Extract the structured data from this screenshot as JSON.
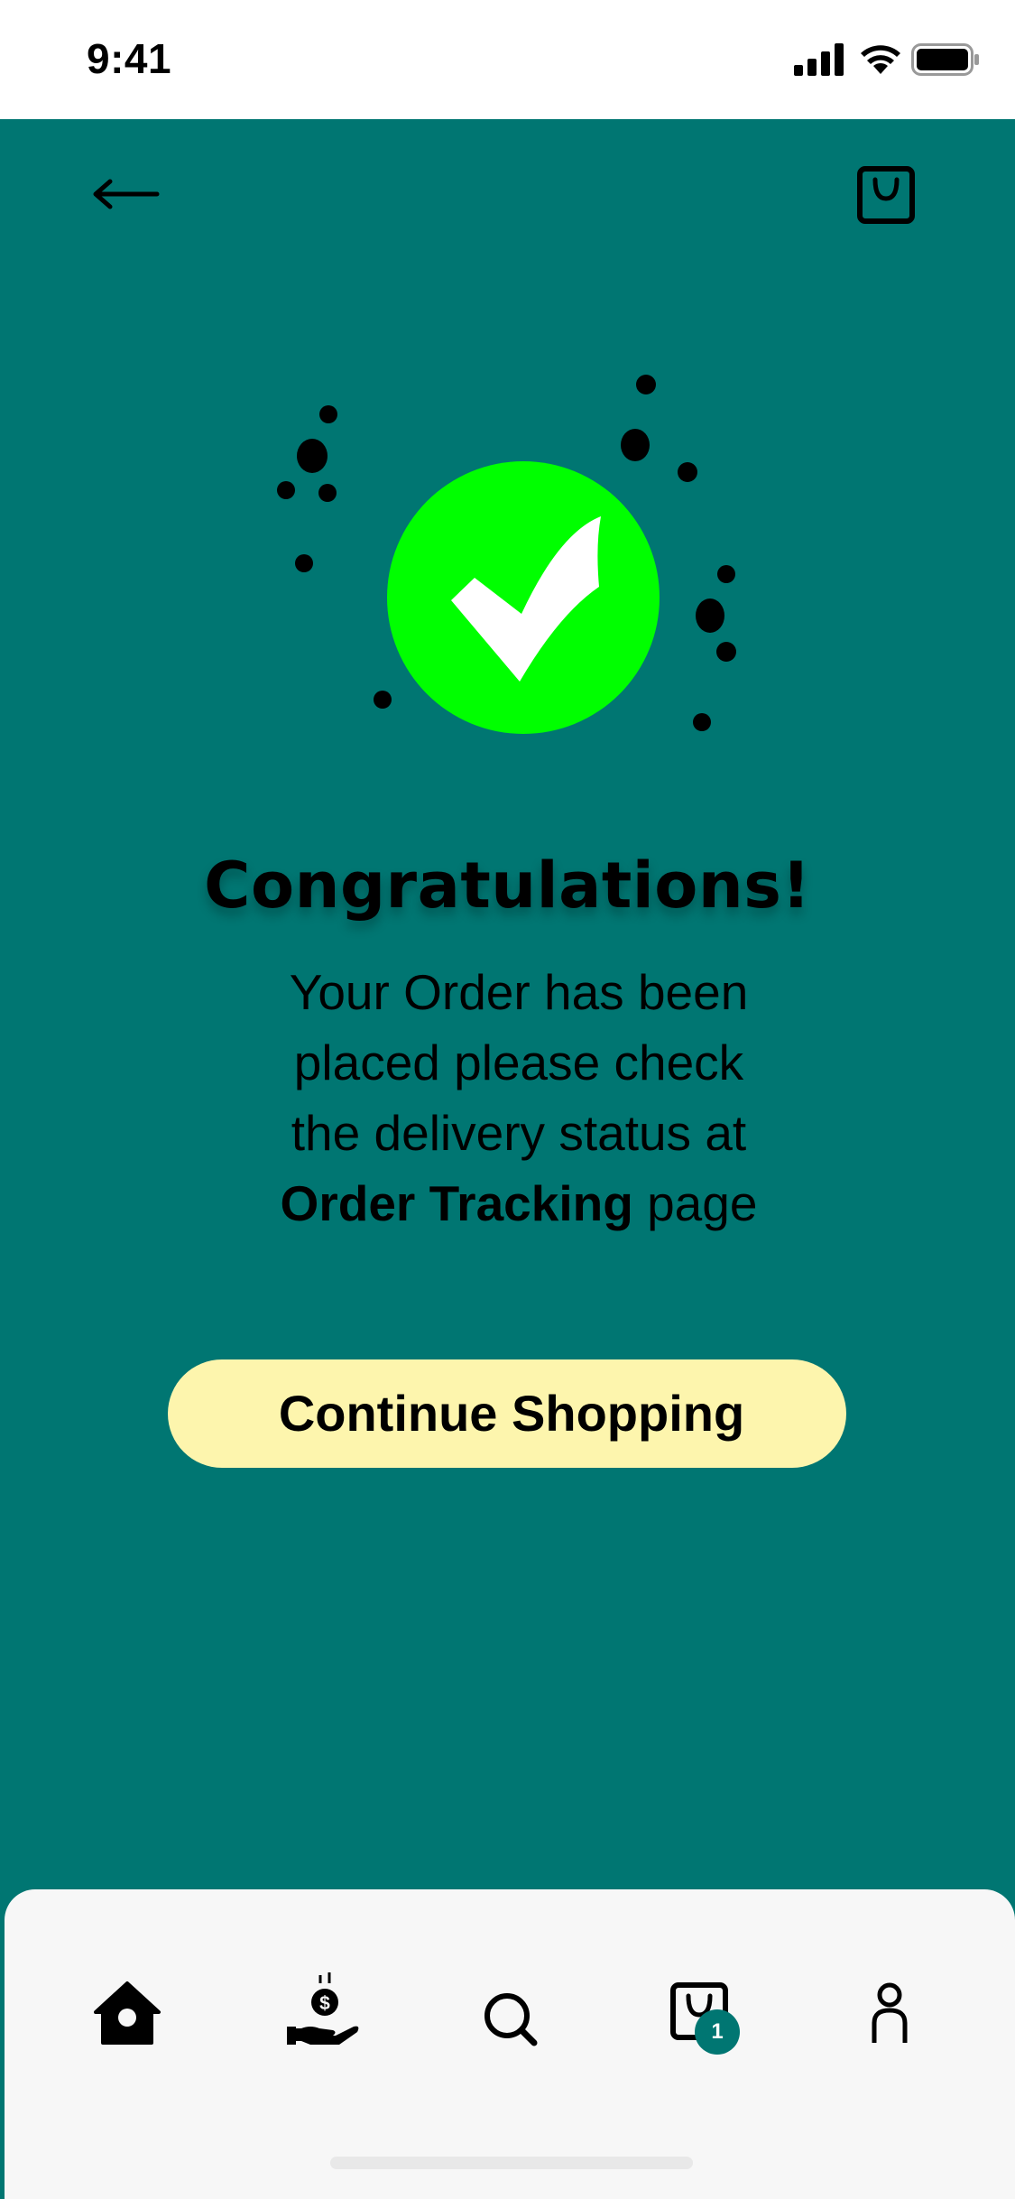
{
  "status_bar": {
    "time": "9:41",
    "icons": [
      "signal-icon",
      "wifi-icon",
      "battery-icon"
    ]
  },
  "header": {
    "back_icon": "arrow-left-icon",
    "cart_icon": "shopping-bag-icon"
  },
  "success": {
    "icon": "check-circle-icon",
    "accent_color": "#00ff00",
    "title": "Congratulations!",
    "message_lines": [
      "Your Order has been",
      "placed please check",
      "the delivery status at"
    ],
    "message_link": "Order Tracking",
    "message_tail": "page"
  },
  "cta": {
    "label": "Continue Shopping",
    "background": "#fdf5ad"
  },
  "tab_bar": {
    "items": [
      {
        "icon": "home-icon",
        "active": true
      },
      {
        "icon": "hand-money-icon",
        "active": false
      },
      {
        "icon": "search-icon",
        "active": false
      },
      {
        "icon": "shopping-bag-icon",
        "active": false
      },
      {
        "icon": "profile-icon",
        "active": false
      }
    ],
    "cart_badge": "1"
  },
  "colors": {
    "background": "#007672",
    "tab_bar": "#f7f7f7",
    "badge": "#007672"
  }
}
